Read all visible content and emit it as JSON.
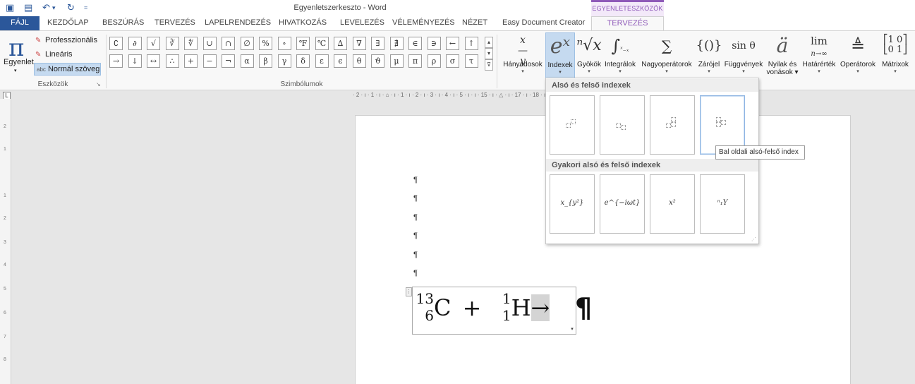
{
  "titlebar": {
    "doc_title": "Egyenletszerkeszto - Word",
    "context_group": "EGYENLETESZKÖZÖK",
    "icons": [
      "word-icon",
      "save-icon",
      "undo-icon",
      "redo-icon",
      "customize-icon"
    ]
  },
  "tabs": [
    "FÁJL",
    "KEZDŐLAP",
    "BESZÚRÁS",
    "TERVEZÉS",
    "LAPELRENDEZÉS",
    "HIVATKOZÁS",
    "LEVELEZÉS",
    "VÉLEMÉNYEZÉS",
    "NÉZET",
    "Easy Document Creator",
    "TERVEZÉS"
  ],
  "tools_group": {
    "label": "Eszközök",
    "equation_label": "Egyenlet",
    "professional": "Professzionális",
    "linear": "Lineáris",
    "normal_text": "Normál szöveg",
    "abc": "abc"
  },
  "symbols_group": {
    "label": "Szimbólumok",
    "row1": [
      "∁",
      "∂",
      "√",
      "∛",
      "∜",
      "∪",
      "∩",
      "∅",
      "%",
      "∘",
      "℉",
      "℃",
      "∆",
      "∇",
      "∃",
      "∄",
      "∈",
      "∋",
      "←",
      "↑"
    ],
    "row2": [
      "→",
      "↓",
      "↔",
      "∴",
      "+",
      "−",
      "¬",
      "α",
      "β",
      "γ",
      "δ",
      "ε",
      "ϵ",
      "θ",
      "ϑ",
      "μ",
      "π",
      "ρ",
      "σ",
      "τ"
    ]
  },
  "structures": [
    {
      "label": "Hányadosok",
      "label2": "",
      "icon": "x/y"
    },
    {
      "label": "Indexek",
      "label2": "",
      "icon": "eˣ"
    },
    {
      "label": "Gyökök",
      "label2": "",
      "icon": "ⁿ√x"
    },
    {
      "label": "Integrálok",
      "label2": "",
      "icon": "∫"
    },
    {
      "label": "Nagyoperátorok",
      "label2": "",
      "icon": "∑"
    },
    {
      "label": "Zárójel",
      "label2": "",
      "icon": "{()}"
    },
    {
      "label": "Függvények",
      "label2": "",
      "icon": "sin θ"
    },
    {
      "label": "Nyilak és",
      "label2": "vonások",
      "icon": "ä"
    },
    {
      "label": "Határérték",
      "label2": "",
      "icon": "lim"
    },
    {
      "label": "Operátorok",
      "label2": "",
      "icon": "≜"
    },
    {
      "label": "Mátrixok",
      "label2": "",
      "icon": "[1 0; 0 1]"
    }
  ],
  "ruler": {
    "text": "· 2 · ı · 1 · ı · ⌂ · ı · 1 · ı · 2 · ı · 3 · ı · 4 · ı · 5 · ı                                                  · ı · 15 · ı · △ · ı · 17 · ı · 18 · ı",
    "vertical": [
      "2",
      "1",
      "1",
      "2",
      "3",
      "4",
      "5",
      "6",
      "7",
      "8"
    ]
  },
  "document": {
    "pilcrow": "¶",
    "equation": {
      "c_mass": "13",
      "c_atomic": "6",
      "c_symbol": "C",
      "plus": "+",
      "h_mass": "1",
      "h_atomic": "1",
      "h_symbol": "H",
      "arrow": "→"
    }
  },
  "gallery": {
    "section1": "Alsó és felső indexek",
    "section2": "Gyakori alsó és felső indexek",
    "common": [
      "x_{y²}",
      "e^{−iωt}",
      "x²",
      "ⁿ₁Y"
    ],
    "tooltip": "Bal oldali alsó-felső index"
  }
}
